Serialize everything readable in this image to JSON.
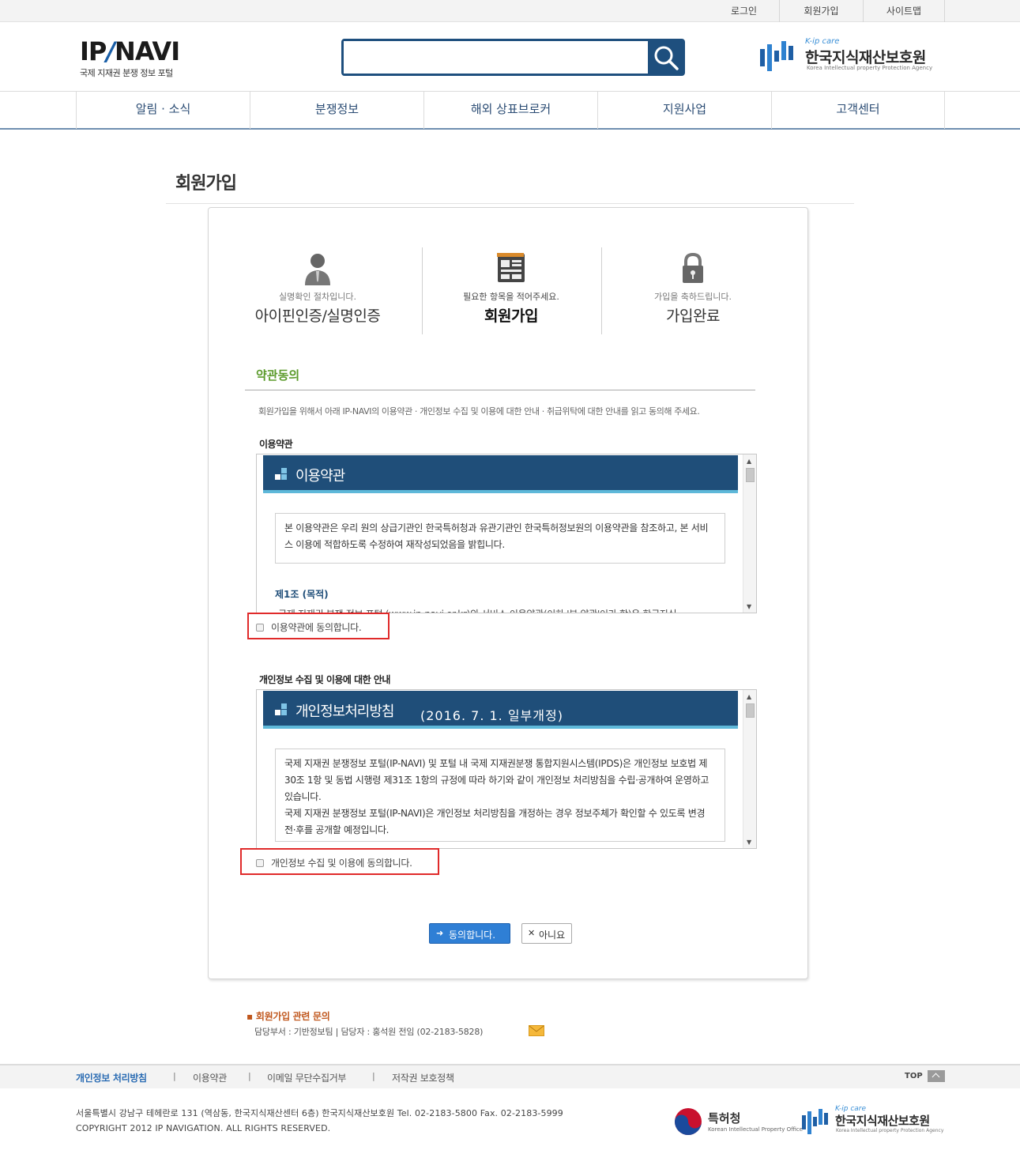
{
  "util_nav": [
    "로그인",
    "회원가입",
    "사이트맵"
  ],
  "logo": {
    "main_a": "IP",
    "main_slash": "/",
    "main_b": "NAVI",
    "sub": "국제 지재권 분쟁 정보 포털"
  },
  "search": {
    "placeholder": "",
    "value": ""
  },
  "agency": {
    "kcare": "K-ip care",
    "name": "한국지식재산보호원",
    "english": "Korea Intellectual property Protection Agency"
  },
  "gnb": [
    "알림 · 소식",
    "분쟁정보",
    "해외 상표브로커",
    "지원사업",
    "고객센터"
  ],
  "page_title": "회원가입",
  "steps": [
    {
      "sub": "실명확인 절차입니다.",
      "main": "아이핀인증/실명인증",
      "icon": "person-icon",
      "active": false
    },
    {
      "sub": "필요한 항목을 적어주세요.",
      "main": "회원가입",
      "icon": "form-document-icon",
      "active": true
    },
    {
      "sub": "가입을 축하드립니다.",
      "main": "가입완료",
      "icon": "lock-icon",
      "active": false
    }
  ],
  "section": {
    "title": "약관동의",
    "desc": "회원가입을 위해서 아래 IP-NAVI의 이용약관 · 개인정보 수집 및 이용에 대한 안내 · 취급위탁에 대한 안내를 읽고 동의해 주세요."
  },
  "terms": {
    "label": "이용약관",
    "banner_title": "이용약관",
    "notice": "본 이용약관은 우리 원의 상급기관인 한국특허청과 유관기관인 한국특허정보원의 이용약관을 참조하고, 본 서비스 이용에 적합하도록 수정하여 재작성되었음을 밝힙니다.",
    "article_title": "제1조 (목적)",
    "cut_line": "국제 지재권 분쟁 정보 포털 (www.ip-navi.or.kr)의 서비스 이용약관(이하 '본 약관'이라 함)은 한국지식",
    "agree_label": "이용약관에 동의합니다."
  },
  "privacy": {
    "label": "개인정보 수집 및 이용에 대한 안내",
    "banner_title": "개인정보처리방침",
    "banner_date": "(2016. 7. 1. 일부개정)",
    "notice": "국제 지재권 분쟁정보 포털(IP-NAVI) 및 포털 내 국제 지재권분쟁 통합지원시스템(IPDS)은 개인정보 보호법 제30조 1항 및 동법 시행령 제31조 1항의 규정에 따라 하기와 같이 개인정보 처리방침을 수립·공개하여 운영하고 있습니다.\n국제 지재권 분쟁정보 포털(IP-NAVI)은 개인정보 처리방침을 개정하는 경우 정보주체가 확인할 수 있도록 변경 전·후를 공개할 예정입니다.",
    "agree_label": "개인정보 수집 및 이용에 동의합니다."
  },
  "buttons": {
    "agree": "동의합니다.",
    "disagree": "아니요"
  },
  "contact": {
    "title": "회원가입 관련 문의",
    "info": "담당부서 : 기반정보팀  |  담당자 : 홍석원 전임 (02-2183-5828)"
  },
  "footer": {
    "links": [
      "개인정보 처리방침",
      "이용약관",
      "이메일 무단수집거부",
      "저작권 보호정책"
    ],
    "top": "TOP",
    "address": "서울특별시 강남구 테헤란로 131 (역삼동, 한국지식재산센터 6층) 한국지식재산보호원 Tel. 02-2183-5800 Fax. 02-2183-5999",
    "copyright": "COPYRIGHT 2012 IP NAVIGATION. ALL RIGHTS RESERVED.",
    "kipo_name": "특허청",
    "kipo_english": "Korean Intellectual Property Office",
    "kpa_kcare": "K-ip care",
    "kpa_name": "한국지식재산보호원",
    "kpa_english": "Korea Intellectual property Protection Agency"
  },
  "colors": {
    "navy": "#1f4e79",
    "accent_green": "#5a9a2a",
    "highlight_red": "#e02a2a",
    "button_blue": "#2f7fd5"
  }
}
